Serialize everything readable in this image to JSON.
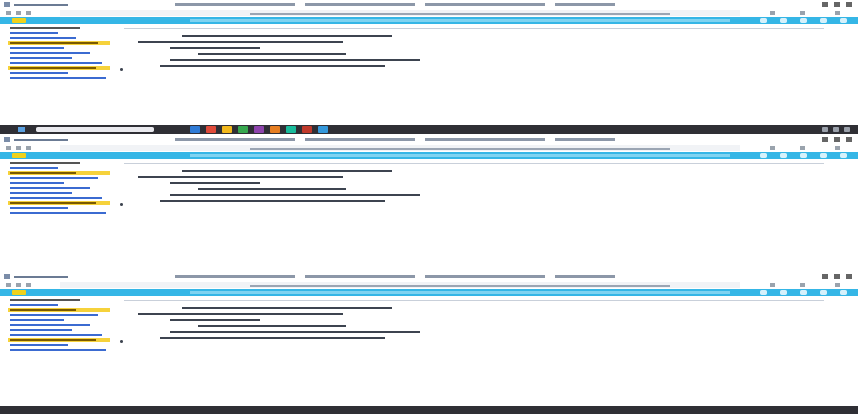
{
  "screenshots": [
    {
      "browser": {
        "tab_title": "",
        "bookmarks": [
          "",
          "",
          "",
          "",
          "",
          ""
        ],
        "url": ""
      },
      "app": {
        "logo_text": "",
        "sidebar": {
          "items": [
            {
              "label": "",
              "selected": false
            },
            {
              "label": "",
              "selected": false
            },
            {
              "label": "",
              "selected": false
            },
            {
              "label": "",
              "selected": true
            },
            {
              "label": "",
              "selected": false
            },
            {
              "label": "",
              "selected": false
            },
            {
              "label": "",
              "selected": false
            },
            {
              "label": "",
              "selected": false
            },
            {
              "label": "",
              "selected": true
            },
            {
              "label": "",
              "selected": false
            },
            {
              "label": "",
              "selected": false
            }
          ]
        },
        "content": {
          "title": "",
          "lines": [
            "",
            "",
            "",
            "",
            "",
            ""
          ]
        }
      }
    },
    {
      "browser": {
        "tab_title": "",
        "bookmarks": [
          "",
          "",
          "",
          "",
          "",
          ""
        ],
        "url": ""
      },
      "app": {
        "logo_text": "",
        "sidebar": {
          "items": [
            {
              "label": "",
              "selected": false
            },
            {
              "label": "",
              "selected": false
            },
            {
              "label": "",
              "selected": true
            },
            {
              "label": "",
              "selected": false
            },
            {
              "label": "",
              "selected": false
            },
            {
              "label": "",
              "selected": false
            },
            {
              "label": "",
              "selected": false
            },
            {
              "label": "",
              "selected": false
            },
            {
              "label": "",
              "selected": true
            },
            {
              "label": "",
              "selected": false
            },
            {
              "label": "",
              "selected": false
            }
          ]
        },
        "content": {
          "title": "",
          "lines": [
            "",
            "",
            "",
            "",
            "",
            ""
          ]
        }
      }
    },
    {
      "browser": {
        "tab_title": "",
        "bookmarks": [
          "",
          "",
          "",
          "",
          "",
          ""
        ],
        "url": ""
      },
      "app": {
        "logo_text": "",
        "sidebar": {
          "items": [
            {
              "label": "",
              "selected": false
            },
            {
              "label": "",
              "selected": false
            },
            {
              "label": "",
              "selected": true
            },
            {
              "label": "",
              "selected": false
            },
            {
              "label": "",
              "selected": false
            },
            {
              "label": "",
              "selected": false
            },
            {
              "label": "",
              "selected": false
            },
            {
              "label": "",
              "selected": false
            },
            {
              "label": "",
              "selected": true
            },
            {
              "label": "",
              "selected": false
            },
            {
              "label": "",
              "selected": false
            }
          ]
        },
        "content": {
          "title": "",
          "lines": [
            "",
            "",
            "",
            "",
            "",
            ""
          ]
        }
      }
    }
  ],
  "taskbar": {
    "app_colors": [
      "#2f7bd6",
      "#e04b3a",
      "#f2b81c",
      "#37a84f",
      "#8e44ad",
      "#e67e22",
      "#1abc9c",
      "#c0392b",
      "#3498db"
    ]
  },
  "colors": {
    "app_bar": "#35b6e6",
    "logo": "#f0d21c",
    "selected_item": "#f6d23b",
    "link": "#3b6bd1",
    "taskbar": "#2f2f35"
  }
}
